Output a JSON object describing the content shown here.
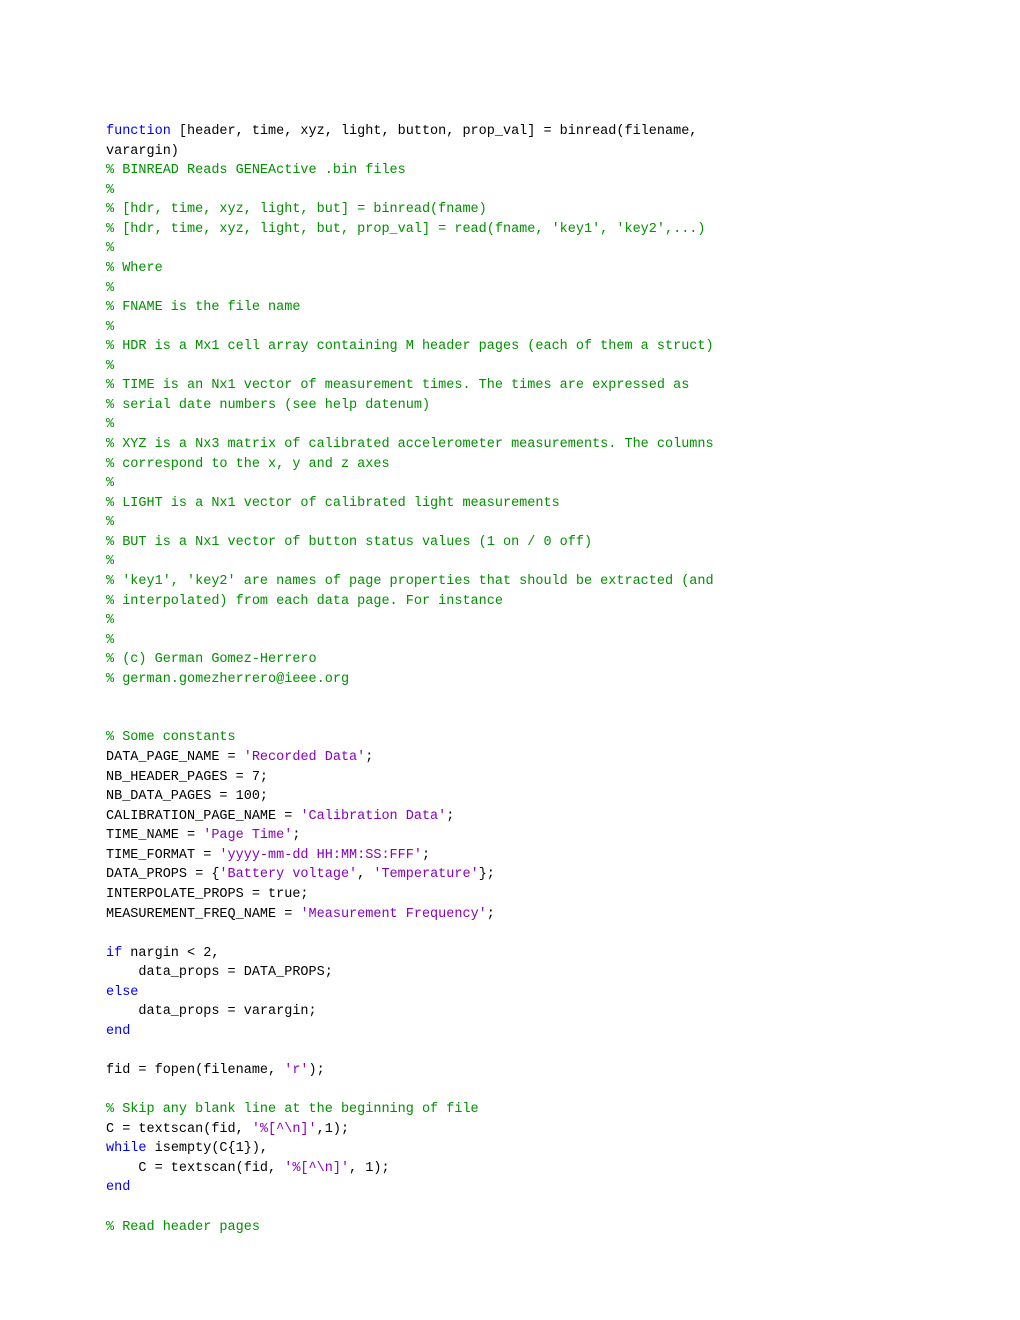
{
  "code_lines": [
    [
      {
        "cls": "kw",
        "text": "function"
      },
      {
        "cls": "def",
        "text": " [header, time, xyz, light, button, prop_val] = binread(filename, "
      }
    ],
    [
      {
        "cls": "def",
        "text": "varargin)"
      }
    ],
    [
      {
        "cls": "com",
        "text": "% BINREAD Reads GENEActive .bin files"
      }
    ],
    [
      {
        "cls": "com",
        "text": "%"
      }
    ],
    [
      {
        "cls": "com",
        "text": "% [hdr, time, xyz, light, but] = binread(fname)"
      }
    ],
    [
      {
        "cls": "com",
        "text": "% [hdr, time, xyz, light, but, prop_val] = read(fname, 'key1', 'key2',...)"
      }
    ],
    [
      {
        "cls": "com",
        "text": "%"
      }
    ],
    [
      {
        "cls": "com",
        "text": "% Where"
      }
    ],
    [
      {
        "cls": "com",
        "text": "%"
      }
    ],
    [
      {
        "cls": "com",
        "text": "% FNAME is the file name"
      }
    ],
    [
      {
        "cls": "com",
        "text": "%"
      }
    ],
    [
      {
        "cls": "com",
        "text": "% HDR is a Mx1 cell array containing M header pages (each of them a struct)"
      }
    ],
    [
      {
        "cls": "com",
        "text": "%"
      }
    ],
    [
      {
        "cls": "com",
        "text": "% TIME is an Nx1 vector of measurement times. The times are expressed as"
      }
    ],
    [
      {
        "cls": "com",
        "text": "% serial date numbers (see help datenum)"
      }
    ],
    [
      {
        "cls": "com",
        "text": "%"
      }
    ],
    [
      {
        "cls": "com",
        "text": "% XYZ is a Nx3 matrix of calibrated accelerometer measurements. The columns"
      }
    ],
    [
      {
        "cls": "com",
        "text": "% correspond to the x, y and z axes"
      }
    ],
    [
      {
        "cls": "com",
        "text": "%"
      }
    ],
    [
      {
        "cls": "com",
        "text": "% LIGHT is a Nx1 vector of calibrated light measurements"
      }
    ],
    [
      {
        "cls": "com",
        "text": "%"
      }
    ],
    [
      {
        "cls": "com",
        "text": "% BUT is a Nx1 vector of button status values (1 on / 0 off)"
      }
    ],
    [
      {
        "cls": "com",
        "text": "%"
      }
    ],
    [
      {
        "cls": "com",
        "text": "% 'key1', 'key2' are names of page properties that should be extracted (and"
      }
    ],
    [
      {
        "cls": "com",
        "text": "% interpolated) from each data page. For instance"
      }
    ],
    [
      {
        "cls": "com",
        "text": "%"
      }
    ],
    [
      {
        "cls": "com",
        "text": "%"
      }
    ],
    [
      {
        "cls": "com",
        "text": "% (c) German Gomez-Herrero"
      }
    ],
    [
      {
        "cls": "com",
        "text": "% german.gomezherrero@ieee.org"
      }
    ],
    [],
    [],
    [
      {
        "cls": "com",
        "text": "% Some constants"
      }
    ],
    [
      {
        "cls": "def",
        "text": "DATA_PAGE_NAME = "
      },
      {
        "cls": "str",
        "text": "'Recorded Data'"
      },
      {
        "cls": "def",
        "text": ";"
      }
    ],
    [
      {
        "cls": "def",
        "text": "NB_HEADER_PAGES = 7;"
      }
    ],
    [
      {
        "cls": "def",
        "text": "NB_DATA_PAGES = 100;"
      }
    ],
    [
      {
        "cls": "def",
        "text": "CALIBRATION_PAGE_NAME = "
      },
      {
        "cls": "str",
        "text": "'Calibration Data'"
      },
      {
        "cls": "def",
        "text": ";"
      }
    ],
    [
      {
        "cls": "def",
        "text": "TIME_NAME = "
      },
      {
        "cls": "str",
        "text": "'Page Time'"
      },
      {
        "cls": "def",
        "text": ";"
      }
    ],
    [
      {
        "cls": "def",
        "text": "TIME_FORMAT = "
      },
      {
        "cls": "str",
        "text": "'yyyy-mm-dd HH:MM:SS:FFF'"
      },
      {
        "cls": "def",
        "text": ";"
      }
    ],
    [
      {
        "cls": "def",
        "text": "DATA_PROPS = {"
      },
      {
        "cls": "str",
        "text": "'Battery voltage'"
      },
      {
        "cls": "def",
        "text": ", "
      },
      {
        "cls": "str",
        "text": "'Temperature'"
      },
      {
        "cls": "def",
        "text": "};"
      }
    ],
    [
      {
        "cls": "def",
        "text": "INTERPOLATE_PROPS = true;"
      }
    ],
    [
      {
        "cls": "def",
        "text": "MEASUREMENT_FREQ_NAME = "
      },
      {
        "cls": "str",
        "text": "'Measurement Frequency'"
      },
      {
        "cls": "def",
        "text": ";"
      }
    ],
    [],
    [
      {
        "cls": "kw",
        "text": "if"
      },
      {
        "cls": "def",
        "text": " nargin < 2,"
      }
    ],
    [
      {
        "cls": "def",
        "text": "    data_props = DATA_PROPS;"
      }
    ],
    [
      {
        "cls": "kw",
        "text": "else"
      }
    ],
    [
      {
        "cls": "def",
        "text": "    data_props = varargin;"
      }
    ],
    [
      {
        "cls": "kw",
        "text": "end"
      }
    ],
    [],
    [
      {
        "cls": "def",
        "text": "fid = fopen(filename, "
      },
      {
        "cls": "str",
        "text": "'r'"
      },
      {
        "cls": "def",
        "text": ");"
      }
    ],
    [],
    [
      {
        "cls": "com",
        "text": "% Skip any blank line at the beginning of file"
      }
    ],
    [
      {
        "cls": "def",
        "text": "C = textscan(fid, "
      },
      {
        "cls": "str",
        "text": "'%[^\\n]'"
      },
      {
        "cls": "def",
        "text": ",1);"
      }
    ],
    [
      {
        "cls": "kw",
        "text": "while"
      },
      {
        "cls": "def",
        "text": " isempty(C{1}),"
      }
    ],
    [
      {
        "cls": "def",
        "text": "    C = textscan(fid, "
      },
      {
        "cls": "str",
        "text": "'%[^\\n]'"
      },
      {
        "cls": "def",
        "text": ", 1);"
      }
    ],
    [
      {
        "cls": "kw",
        "text": "end"
      }
    ],
    [],
    [
      {
        "cls": "com",
        "text": "% Read header pages"
      }
    ]
  ]
}
